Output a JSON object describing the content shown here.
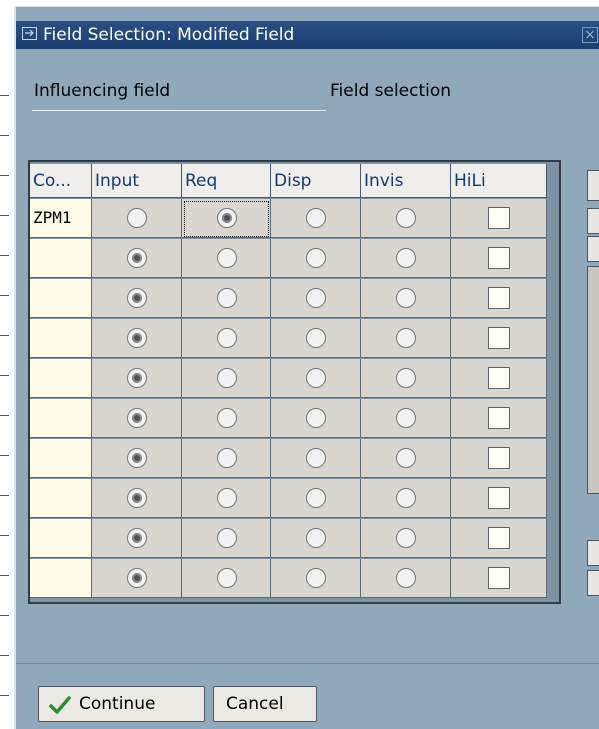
{
  "window": {
    "title": "Field Selection: Modified Field"
  },
  "labels": {
    "influencing_field": "Influencing field",
    "field_selection": "Field selection"
  },
  "table": {
    "headers": [
      "Co...",
      "Input",
      "Req",
      "Disp",
      "Invis",
      "HiLi"
    ],
    "rows": [
      {
        "code": "ZPM1",
        "selected": "Req",
        "hili": false
      },
      {
        "code": "",
        "selected": "Input",
        "hili": false
      },
      {
        "code": "",
        "selected": "Input",
        "hili": false
      },
      {
        "code": "",
        "selected": "Input",
        "hili": false
      },
      {
        "code": "",
        "selected": "Input",
        "hili": false
      },
      {
        "code": "",
        "selected": "Input",
        "hili": false
      },
      {
        "code": "",
        "selected": "Input",
        "hili": false
      },
      {
        "code": "",
        "selected": "Input",
        "hili": false
      },
      {
        "code": "",
        "selected": "Input",
        "hili": false
      },
      {
        "code": "",
        "selected": "Input",
        "hili": false
      }
    ]
  },
  "buttons": {
    "continue": "Continue",
    "cancel": "Cancel"
  },
  "icons": {
    "continue": "checkmark-icon",
    "title": "window-icon",
    "close": "close-icon"
  },
  "colors": {
    "title_bar": "#1d3f72",
    "dialog_bg": "#8fa8ba",
    "header_text": "#123a74",
    "check_green": "#2e8b2e"
  }
}
